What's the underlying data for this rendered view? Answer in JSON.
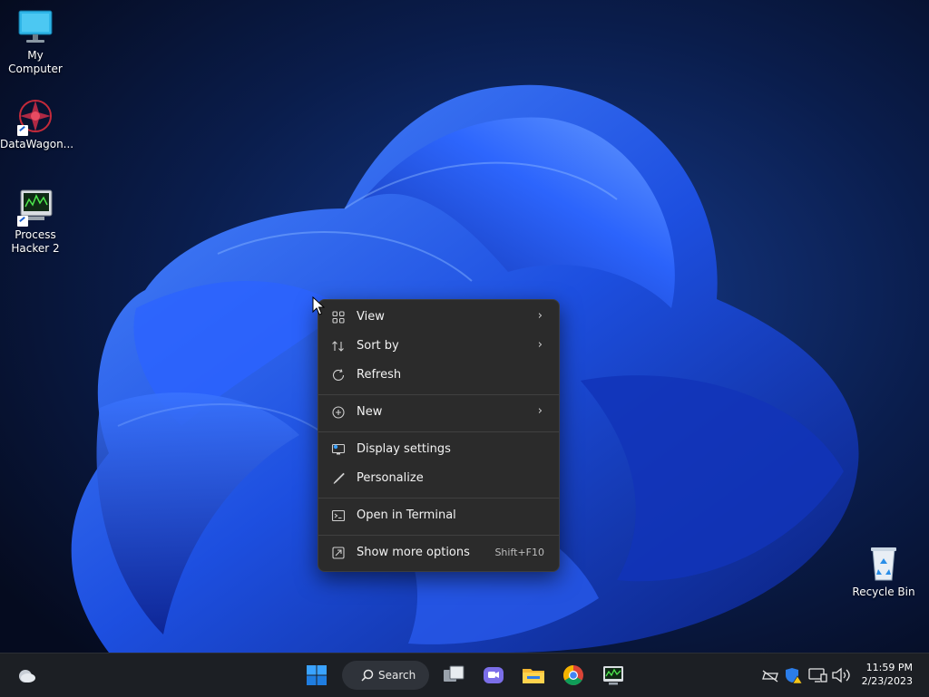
{
  "desktop": {
    "icons": [
      {
        "label": "My Computer",
        "icon": "monitor-icon"
      },
      {
        "label": "DataWagon...",
        "icon": "datawagon-icon"
      },
      {
        "label": "Process Hacker 2",
        "icon": "process-hacker-icon"
      },
      {
        "label": "Recycle Bin",
        "icon": "recycle-bin-icon"
      }
    ]
  },
  "context_menu": {
    "items": [
      {
        "label": "View",
        "icon": "grid-icon",
        "submenu": true
      },
      {
        "label": "Sort by",
        "icon": "sort-icon",
        "submenu": true
      },
      {
        "label": "Refresh",
        "icon": "refresh-icon",
        "submenu": false
      },
      {
        "label": "New",
        "icon": "plus-circle-icon",
        "submenu": true
      },
      {
        "label": "Display settings",
        "icon": "display-icon",
        "submenu": false
      },
      {
        "label": "Personalize",
        "icon": "brush-icon",
        "submenu": false
      },
      {
        "label": "Open in Terminal",
        "icon": "terminal-icon",
        "submenu": false
      },
      {
        "label": "Show more options",
        "icon": "more-options-icon",
        "shortcut": "Shift+F10"
      }
    ],
    "chevron": "›"
  },
  "taskbar": {
    "search_label": "Search",
    "time": "11:59 PM",
    "date": "2/23/2023",
    "apps": [
      "widgets-icon",
      "start-icon",
      "search-icon",
      "task-view-icon",
      "teams-icon",
      "file-explorer-icon",
      "chrome-icon",
      "process-hacker-taskbar-icon"
    ],
    "tray": [
      "network-off-icon",
      "security-warning-icon",
      "display-tray-icon",
      "volume-icon"
    ]
  },
  "colors": {
    "accent": "#1a5fd0",
    "menu_bg": "#2b2b2b",
    "taskbar_bg": "#1c1f24"
  }
}
